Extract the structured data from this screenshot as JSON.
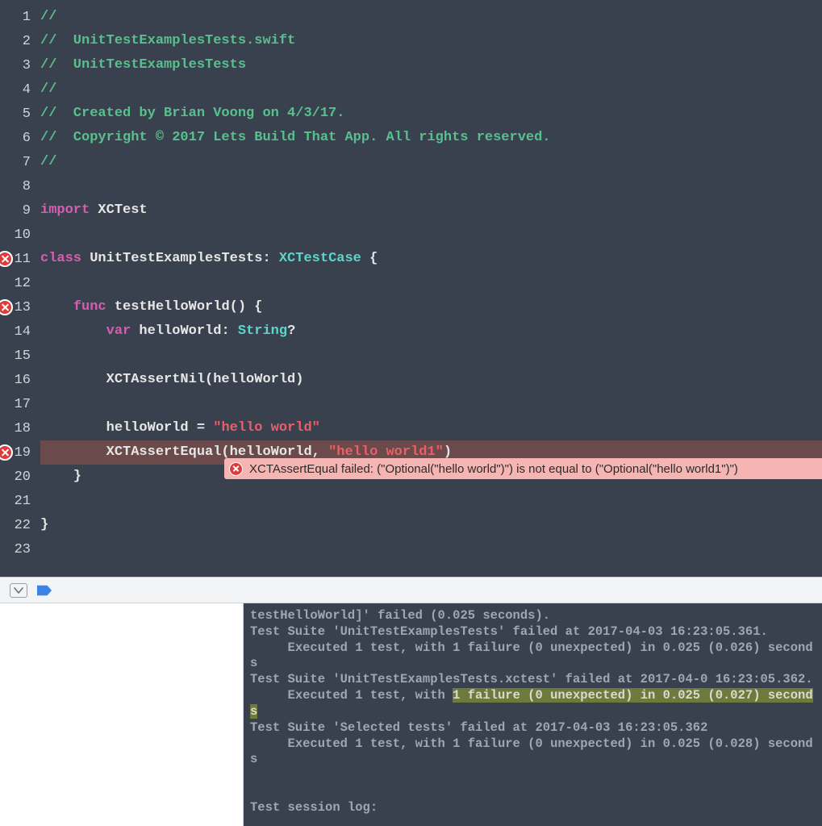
{
  "editor": {
    "lines": [
      {
        "n": 1,
        "err": false,
        "tokens": [
          [
            "comment",
            "//"
          ]
        ]
      },
      {
        "n": 2,
        "err": false,
        "tokens": [
          [
            "comment",
            "//  UnitTestExamplesTests.swift"
          ]
        ]
      },
      {
        "n": 3,
        "err": false,
        "tokens": [
          [
            "comment",
            "//  UnitTestExamplesTests"
          ]
        ]
      },
      {
        "n": 4,
        "err": false,
        "tokens": [
          [
            "comment",
            "//"
          ]
        ]
      },
      {
        "n": 5,
        "err": false,
        "tokens": [
          [
            "comment",
            "//  Created by Brian Voong on 4/3/17."
          ]
        ]
      },
      {
        "n": 6,
        "err": false,
        "tokens": [
          [
            "comment",
            "//  Copyright © 2017 Lets Build That App. All rights reserved."
          ]
        ]
      },
      {
        "n": 7,
        "err": false,
        "tokens": [
          [
            "comment",
            "//"
          ]
        ]
      },
      {
        "n": 8,
        "err": false,
        "tokens": []
      },
      {
        "n": 9,
        "err": false,
        "tokens": [
          [
            "keyword",
            "import"
          ],
          [
            "plain",
            " XCTest"
          ]
        ]
      },
      {
        "n": 10,
        "err": false,
        "tokens": []
      },
      {
        "n": 11,
        "err": true,
        "tokens": [
          [
            "keyword",
            "class"
          ],
          [
            "plain",
            " UnitTestExamplesTests: "
          ],
          [
            "type",
            "XCTestCase"
          ],
          [
            "plain",
            " {"
          ]
        ]
      },
      {
        "n": 12,
        "err": false,
        "tokens": []
      },
      {
        "n": 13,
        "err": true,
        "tokens": [
          [
            "plain",
            "    "
          ],
          [
            "keyword",
            "func"
          ],
          [
            "plain",
            " testHelloWorld() {"
          ]
        ]
      },
      {
        "n": 14,
        "err": false,
        "tokens": [
          [
            "plain",
            "        "
          ],
          [
            "keyword",
            "var"
          ],
          [
            "plain",
            " helloWorld: "
          ],
          [
            "type",
            "String"
          ],
          [
            "plain",
            "?"
          ]
        ]
      },
      {
        "n": 15,
        "err": false,
        "tokens": []
      },
      {
        "n": 16,
        "err": false,
        "tokens": [
          [
            "plain",
            "        XCTAssertNil(helloWorld)"
          ]
        ]
      },
      {
        "n": 17,
        "err": false,
        "tokens": []
      },
      {
        "n": 18,
        "err": false,
        "tokens": [
          [
            "plain",
            "        helloWorld = "
          ],
          [
            "string",
            "\"hello world\""
          ]
        ]
      },
      {
        "n": 19,
        "err": true,
        "hl": true,
        "tokens": [
          [
            "plain",
            "        XCTAssertEqual(helloWorld, "
          ],
          [
            "string",
            "\"hello world1\""
          ],
          [
            "plain",
            ")"
          ]
        ]
      },
      {
        "n": 20,
        "err": false,
        "tokens": [
          [
            "plain",
            "    }"
          ]
        ]
      },
      {
        "n": 21,
        "err": false,
        "tokens": []
      },
      {
        "n": 22,
        "err": false,
        "tokens": [
          [
            "plain",
            "}"
          ]
        ]
      },
      {
        "n": 23,
        "err": false,
        "tokens": []
      }
    ],
    "inline_error": "XCTAssertEqual failed: (\"Optional(\"hello world\")\") is not equal to (\"Optional(\"hello world1\")\")"
  },
  "console": {
    "segments": [
      {
        "sel": false,
        "text": "testHelloWorld]' failed (0.025 seconds).\nTest Suite 'UnitTestExamplesTests' failed at 2017-04-03 16:23:05.361.\n     Executed 1 test, with 1 failure (0 unexpected) in 0.025 (0.026) seconds\nTest Suite 'UnitTestExamplesTests.xctest' failed at 2017-04-0 16:23:05.362.\n     Executed 1 test, with "
      },
      {
        "sel": true,
        "text": "1 failure (0 unexpected) in 0.025 (0.027) seconds"
      },
      {
        "sel": false,
        "text": "\nTest Suite 'Selected tests' failed at 2017-04-03 16:23:05.362\n     Executed 1 test, with 1 failure (0 unexpected) in 0.025 (0.028) seconds\n\n\nTest session log:"
      }
    ]
  }
}
